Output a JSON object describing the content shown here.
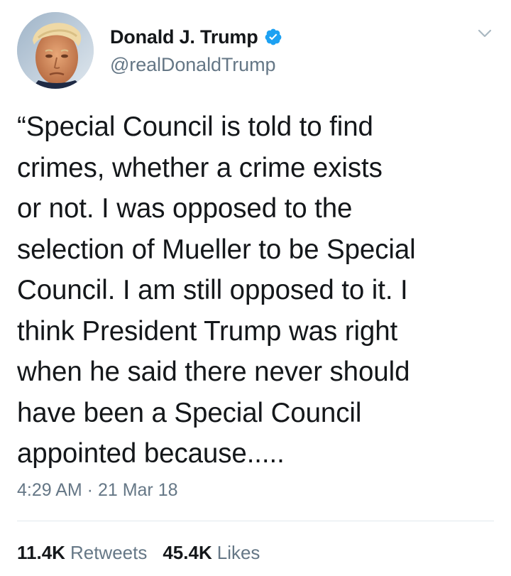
{
  "author": {
    "display_name": "Donald J. Trump",
    "handle": "@realDonaldTrump",
    "verified": true,
    "avatar_icon": "profile-photo-avatar",
    "verified_icon": "verified-badge-icon",
    "verified_color": "#1da1f2"
  },
  "menu": {
    "icon": "chevron-down-icon"
  },
  "tweet": {
    "lines": [
      "“Special Council is told to find",
      "crimes, whether a crime exists",
      "or not. I was opposed to the",
      "selection of Mueller to be Special",
      "Council. I am still opposed to it. I",
      "think President Trump was right",
      "when he said there never should",
      "have been a Special Council",
      "appointed because....."
    ],
    "timestamp": "4:29 AM · 21 Mar 18"
  },
  "stats": {
    "retweets_count": "11.4K",
    "retweets_label": "Retweets",
    "likes_count": "45.4K",
    "likes_label": "Likes"
  },
  "colors": {
    "text_primary": "#14171a",
    "text_secondary": "#657786",
    "divider": "#e1e8ed"
  }
}
